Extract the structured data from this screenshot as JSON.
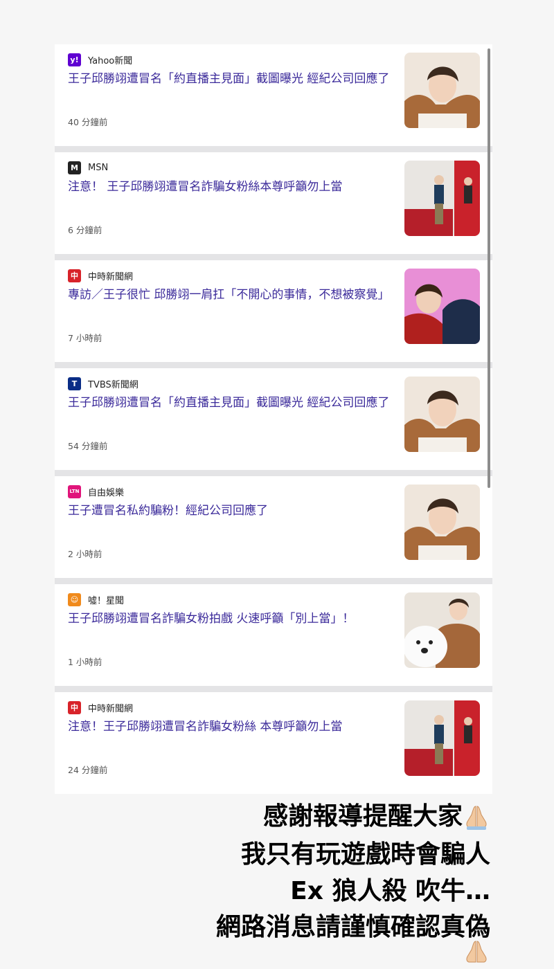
{
  "feed": {
    "articles": [
      {
        "source": "Yahoo新聞",
        "logo": "yahoo-icon",
        "logo_text": "y!",
        "logo_color": "#5f01d1",
        "headline": "王子邱勝翊遭冒名「約直播主見面」截圖曝光 經紀公司回應了",
        "time": "40 分鐘前",
        "thumb": "portrait-brown-jacket"
      },
      {
        "source": "MSN",
        "logo": "msn-icon",
        "logo_text": "M",
        "logo_color": "#222222",
        "headline": "注意！ 王子邱勝翊遭冒名詐騙女粉絲本尊呼籲勿上當",
        "time": "6 分鐘前",
        "thumb": "event-stage-red-banner"
      },
      {
        "source": "中時新聞網",
        "logo": "chinatimes-icon",
        "logo_text": "中",
        "logo_color": "#d8232a",
        "headline": "專訪／王子很忙 邱勝翊一肩扛「不開心的事情，不想被察覺」",
        "time": "7 小時前",
        "thumb": "portrait-pink-background"
      },
      {
        "source": "TVBS新聞網",
        "logo": "tvbs-icon",
        "logo_text": "T",
        "logo_color": "#0a2d86",
        "headline": "王子邱勝翊遭冒名「約直播主見面」截圖曝光 經紀公司回應了",
        "time": "54 分鐘前",
        "thumb": "portrait-brown-jacket"
      },
      {
        "source": "自由娛樂",
        "logo": "ltn-icon",
        "logo_text": "LTN",
        "logo_color": "#e0147a",
        "headline": "王子遭冒名私約騙粉！經紀公司回應了",
        "time": "2 小時前",
        "thumb": "portrait-brown-jacket"
      },
      {
        "source": "噓！星聞",
        "logo": "starnews-icon",
        "logo_text": "☺",
        "logo_color": "#f08a1c",
        "headline": "王子邱勝翊遭冒名詐騙女粉拍戲 火速呼籲「別上當」！",
        "time": "1 小時前",
        "thumb": "portrait-white-dog"
      },
      {
        "source": "中時新聞網",
        "logo": "chinatimes-icon",
        "logo_text": "中",
        "logo_color": "#d8232a",
        "headline": "注意！王子邱勝翊遭冒名詐騙女粉絲 本尊呼籲勿上當",
        "time": "24 分鐘前",
        "thumb": "event-stage-red-banner"
      }
    ]
  },
  "caption": {
    "lines": [
      "感謝報導提醒大家",
      "我只有玩遊戲時會騙人",
      "Ex 狼人殺 吹牛…",
      "網路消息請謹慎確認真偽"
    ],
    "emoji": "praying-hands-icon"
  }
}
